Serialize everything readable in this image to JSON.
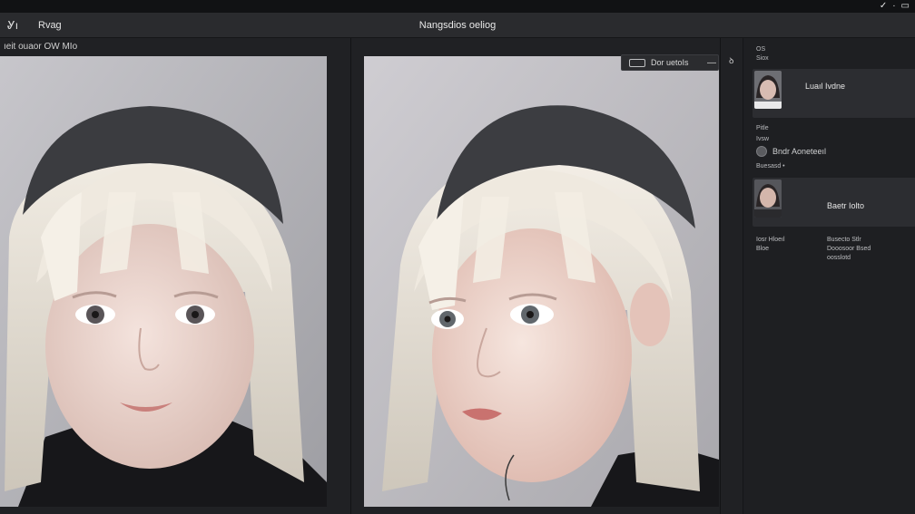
{
  "system_bar": {
    "icons": [
      "check-icon",
      "dot-icon",
      "folder-icon"
    ],
    "glyphs": [
      "✓",
      "·",
      "▭"
    ]
  },
  "toolbar": {
    "tool_icon": "Ꮍı",
    "menu_label": "Rvag",
    "window_title": "Nangsdios oeliog"
  },
  "left_panel": {
    "header": "ıeit ouaor OW MIo"
  },
  "right_panel": {
    "chip_label": "Dor uetoIs",
    "chip_dash": "—",
    "side_toggle": "ꝺ"
  },
  "sidebar": {
    "label_top_1": "OS",
    "label_top_2": "Siox",
    "card1_name": "Luaıl Ivdne",
    "label_mid_1": "Pitle",
    "label_mid_2": "Ivsw",
    "row_label": "Bndr Aoneteeıl",
    "label_mid_3": "Buesasd •",
    "card2_name": "Baetr Iolto",
    "details_left": [
      "Iosr Hloeıl",
      "Bloe"
    ],
    "details_right": [
      "Busecto Stlr",
      "Dooosoor Bsed",
      "oosslotd"
    ]
  },
  "colors": {
    "background": "#202124",
    "toolbar": "#2a2b2e",
    "sidebar": "#1e1f22",
    "card": "#2c2d31"
  }
}
